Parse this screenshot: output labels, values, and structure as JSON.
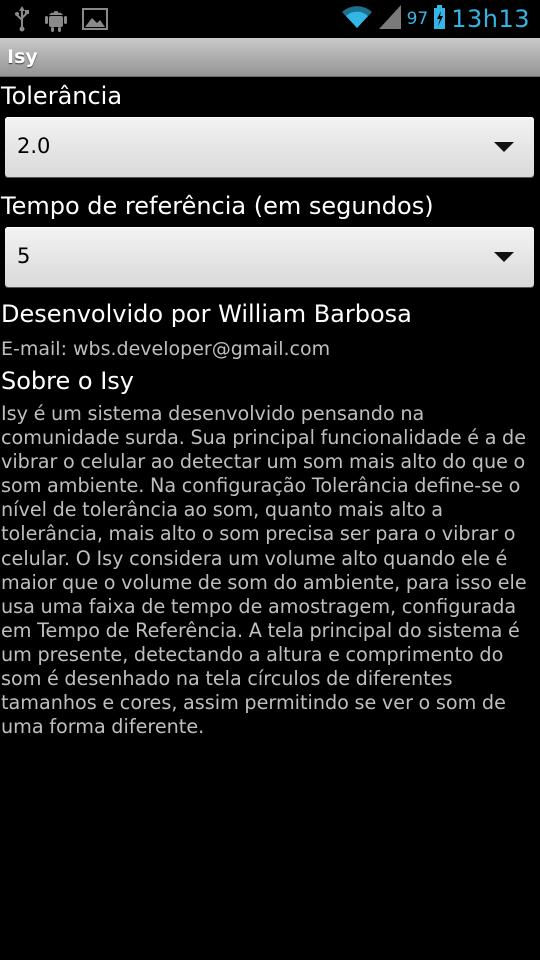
{
  "status_bar": {
    "icons_left": [
      "usb-icon",
      "android-debug-icon",
      "picture-icon"
    ],
    "battery_percent": "97",
    "clock": "13h13",
    "accent_color": "#33b5e5"
  },
  "app": {
    "title": "Isy"
  },
  "settings": {
    "tolerance_label": "Tolerância",
    "tolerance_value": "2.0",
    "reference_time_label": "Tempo de referência (em segundos)",
    "reference_time_value": "5"
  },
  "about": {
    "developer": "Desenvolvido por William Barbosa",
    "email": "E-mail: wbs.developer@gmail.com",
    "title": "Sobre o Isy",
    "description": "Isy é um sistema desenvolvido pensando na comunidade surda. Sua principal funcionalidade é a de vibrar o celular ao detectar um som mais alto do que o som ambiente. Na configuração Tolerância define-se o nível de tolerância ao som, quanto mais alto a tolerância, mais alto o som precisa ser para o vibrar o celular. O Isy considera um volume alto quando ele é maior que o volume de som do ambiente, para isso ele usa uma faixa de tempo de amostragem, configurada em Tempo de Referência. A tela principal do sistema é um presente, detectando a altura e comprimento do som é desenhado na tela círculos de diferentes tamanhos e cores, assim permitindo se ver o som de uma forma diferente."
  }
}
